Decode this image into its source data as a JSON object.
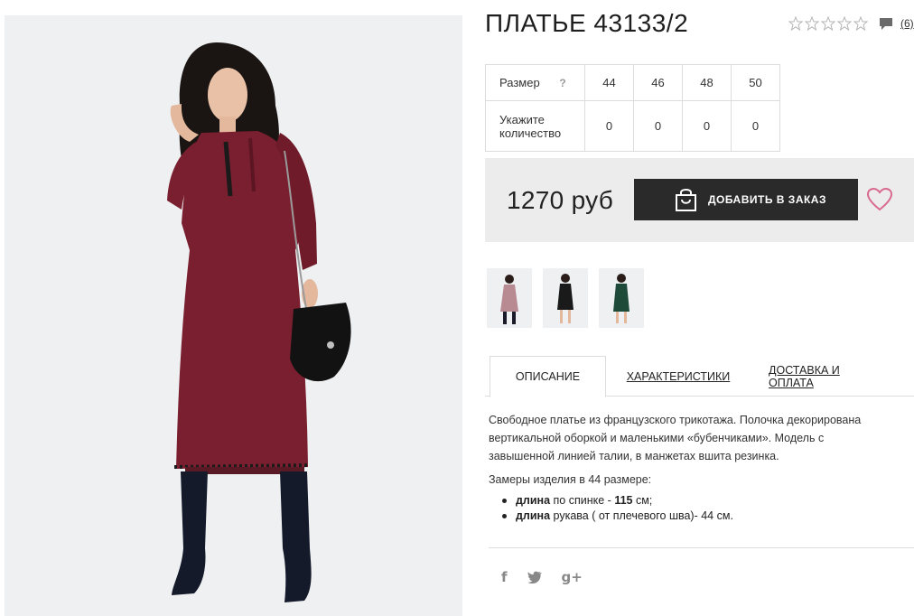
{
  "product": {
    "title": "ПЛАТЬЕ 43133/2",
    "rating_stars": 0,
    "rating_max": 5,
    "review_count": "(6)"
  },
  "sizes": {
    "size_label": "Размер",
    "help_icon": "?",
    "qty_label_line1": "Укажите",
    "qty_label_line2": "количество",
    "values": [
      "44",
      "46",
      "48",
      "50"
    ],
    "quantities": [
      "0",
      "0",
      "0",
      "0"
    ]
  },
  "purchase": {
    "price": "1270 руб",
    "add_button": "ДОБАВИТЬ В ЗАКАЗ",
    "accent_color": "#d86a90",
    "button_color": "#2a2a2a"
  },
  "thumbnails": [
    {
      "color": "#8a2533"
    },
    {
      "color": "#1a1a1a"
    },
    {
      "color": "#1e4a3a"
    }
  ],
  "tabs": [
    "ОПИСАНИЕ",
    "ХАРАКТЕРИСТИКИ",
    "ДОСТАВКА И ОПЛАТА"
  ],
  "description": {
    "line1": "Свободное платье из французского трикотажа. Полочка декорирована",
    "line2": "вертикальной оборкой и маленькими «бубенчиками». Модель с",
    "line3": "завышенной линией талии, в манжетах вшита резинка.",
    "measure_title": "Замеры изделия в 44 размере:",
    "bullet1_bold": "длина",
    "bullet1_rest": " по спинке - ",
    "bullet1_value": "115",
    "bullet1_unit": " см;",
    "bullet2_bold": "длина",
    "bullet2_rest": " рукава ( от плечевого шва)- 44 см."
  },
  "social": {
    "facebook": "f",
    "twitter": "t",
    "gplus": "g+"
  },
  "icons": [
    "star-icon",
    "comment-icon",
    "help-icon",
    "shopping-bag-icon",
    "heart-icon",
    "facebook-icon",
    "twitter-icon",
    "google-plus-icon"
  ]
}
